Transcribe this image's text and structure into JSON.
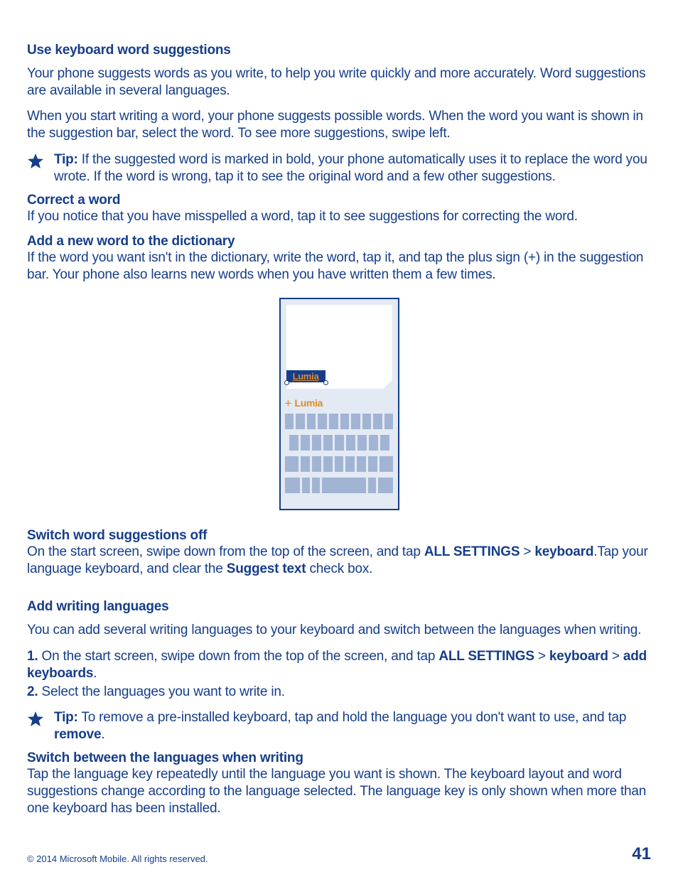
{
  "sec1": {
    "title": "Use keyboard word suggestions",
    "p1": "Your phone suggests words as you write, to help you write quickly and more accurately. Word suggestions are available in several languages.",
    "p2": "When you start writing a word, your phone suggests possible words. When the word you want is shown in the suggestion bar, select the word. To see more suggestions, swipe left.",
    "tip_label": "Tip:",
    "tip_body": " If the suggested word is marked in bold, your phone automatically uses it to replace the word you wrote. If the word is wrong, tap it to see the original word and a few other suggestions."
  },
  "sec2": {
    "title": "Correct a word",
    "body": "If you notice that you have misspelled a word, tap it to see suggestions for correcting the word."
  },
  "sec3": {
    "title": "Add a new word to the dictionary",
    "body": "If the word you want isn't in the dictionary, write the word, tap it, and tap the plus sign (+) in the suggestion bar. Your phone also learns new words when you have written them a few times."
  },
  "illus": {
    "word": "Lumia",
    "plus": "+",
    "suggestion": "Lumia"
  },
  "sec4": {
    "title": "Switch word suggestions off",
    "pre": "On the start screen, swipe down from the top of the screen, and tap ",
    "b1": "ALL SETTINGS",
    "sep": " > ",
    "b2": "keyboard",
    "post": ".Tap your language keyboard, and clear the ",
    "b3": "Suggest text",
    "tail": " check box."
  },
  "sec5": {
    "title": "Add writing languages",
    "intro": "You can add several writing languages to your keyboard and switch between the languages when writing.",
    "s1n": "1.",
    "s1a": " On the start screen, swipe down from the top of the screen, and tap ",
    "s1b1": "ALL SETTINGS",
    "s1sep": " > ",
    "s1b2": "keyboard",
    "s1sep2": " > ",
    "s1b3": "add keyboards",
    "s1tail": ".",
    "s2n": "2.",
    "s2": " Select the languages you want to write in.",
    "tip_label": "Tip:",
    "tip_body_a": " To remove a pre-installed keyboard, tap and hold the language you don't want to use, and tap ",
    "tip_body_b": "remove",
    "tip_body_c": "."
  },
  "sec6": {
    "title": "Switch between the languages when writing",
    "body": "Tap the language key repeatedly until the language you want is shown. The keyboard layout and word suggestions change according to the language selected. The language key is only shown when more than one keyboard has been installed."
  },
  "footer": {
    "copy": "© 2014 Microsoft Mobile. All rights reserved.",
    "page": "41"
  }
}
